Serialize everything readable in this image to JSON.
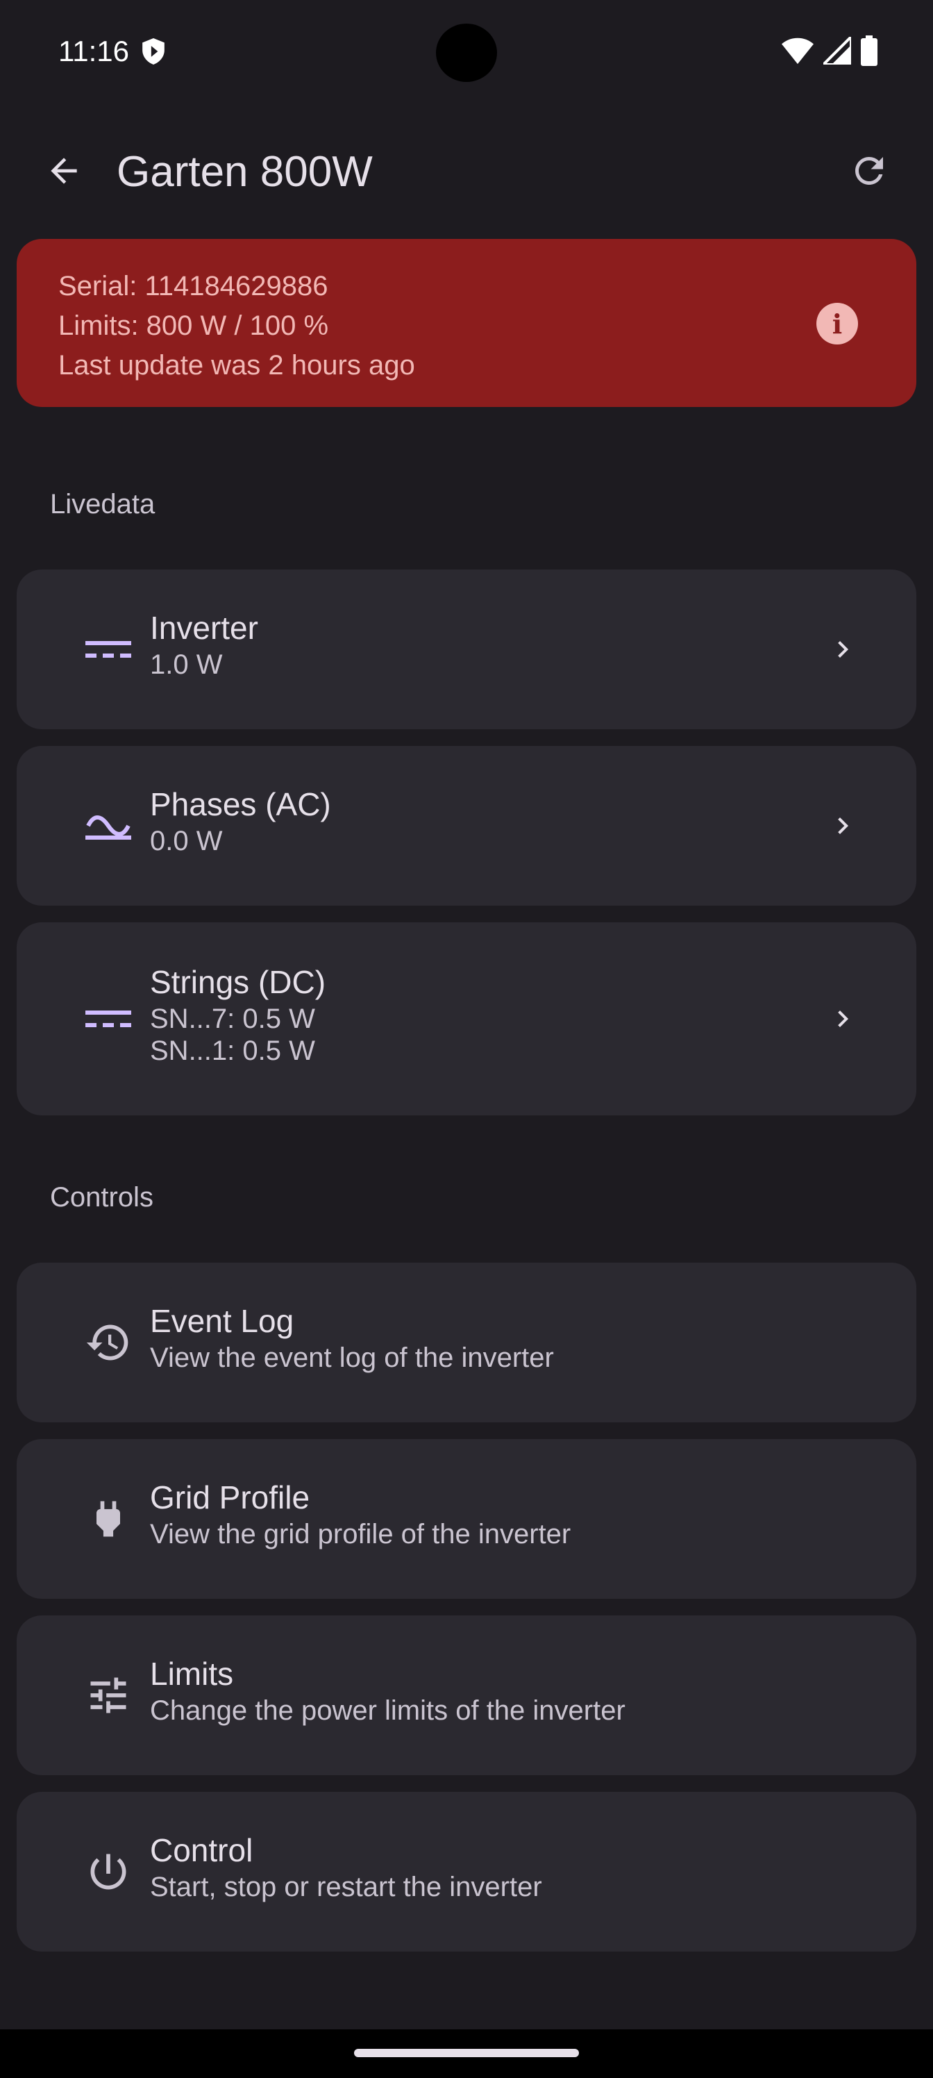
{
  "status_bar": {
    "time": "11:16"
  },
  "app_bar": {
    "title": "Garten 800W"
  },
  "banner": {
    "serial": "Serial: 114184629886",
    "limits": "Limits: 800 W / 100 %",
    "last_update": "Last update was 2 hours ago"
  },
  "livedata": {
    "label": "Livedata",
    "items": [
      {
        "title": "Inverter",
        "lines": [
          "1.0 W"
        ],
        "icon": "dc-icon"
      },
      {
        "title": "Phases (AC)",
        "lines": [
          "0.0 W"
        ],
        "icon": "ac-wave-icon"
      },
      {
        "title": "Strings (DC)",
        "lines": [
          "SN...7: 0.5 W",
          "SN...1: 0.5 W"
        ],
        "icon": "dc-icon"
      }
    ]
  },
  "controls": {
    "label": "Controls",
    "items": [
      {
        "title": "Event Log",
        "subtitle": "View the event log of the inverter",
        "icon": "history-icon"
      },
      {
        "title": "Grid Profile",
        "subtitle": "View the grid profile of the inverter",
        "icon": "plug-icon"
      },
      {
        "title": "Limits",
        "subtitle": "Change the power limits of the inverter",
        "icon": "tune-icon"
      },
      {
        "title": "Control",
        "subtitle": "Start, stop or restart the inverter",
        "icon": "power-icon"
      }
    ]
  },
  "colors": {
    "background": "#1d1b20",
    "card": "#2b2930",
    "banner": "#8c1d1d",
    "banner_text": "#f2b8b5",
    "accent_icon": "#d0bcff"
  }
}
